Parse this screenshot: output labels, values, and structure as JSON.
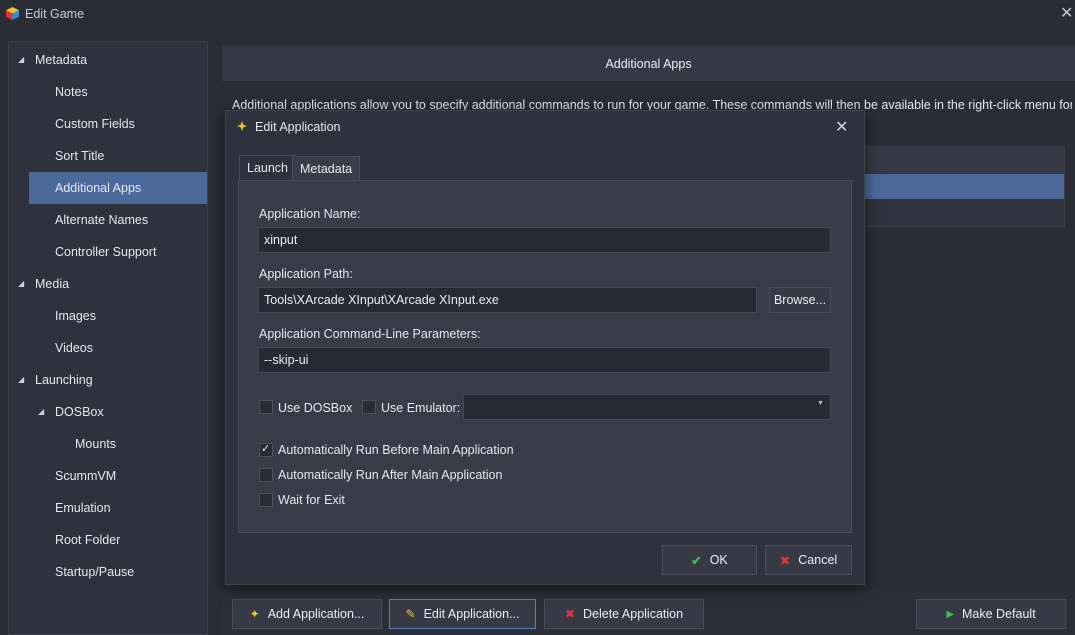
{
  "window": {
    "title": "Edit Game",
    "close_glyph": "✕"
  },
  "sidebar": {
    "items": [
      {
        "label": "Metadata",
        "expanded": true,
        "selected": false
      },
      {
        "label": "Notes",
        "selected": false
      },
      {
        "label": "Custom Fields",
        "selected": false
      },
      {
        "label": "Sort Title",
        "selected": false
      },
      {
        "label": "Additional Apps",
        "selected": true
      },
      {
        "label": "Alternate Names",
        "selected": false
      },
      {
        "label": "Controller Support",
        "selected": false
      },
      {
        "label": "Media",
        "expanded": true,
        "selected": false
      },
      {
        "label": "Images",
        "selected": false
      },
      {
        "label": "Videos",
        "selected": false
      },
      {
        "label": "Launching",
        "expanded": true,
        "selected": false
      },
      {
        "label": "DOSBox",
        "expanded": true,
        "selected": false
      },
      {
        "label": "Mounts",
        "selected": false
      },
      {
        "label": "ScummVM",
        "selected": false
      },
      {
        "label": "Emulation",
        "selected": false
      },
      {
        "label": "Root Folder",
        "selected": false
      },
      {
        "label": "Startup/Pause",
        "selected": false
      }
    ]
  },
  "main": {
    "header": "Additional Apps",
    "description": "Additional applications allow you to specify additional commands to run for your game.  These commands will then be available in the right-click menu for",
    "buttons": {
      "add": "Add Application...",
      "edit": "Edit Application...",
      "delete": "Delete Application",
      "make_default": "Make Default"
    }
  },
  "dialog": {
    "title": "Edit Application",
    "close_glyph": "✕",
    "tabs": [
      "Launch",
      "Metadata"
    ],
    "active_tab": "Launch",
    "fields": {
      "name_label": "Application Name:",
      "name_value": "xinput",
      "path_label": "Application Path:",
      "path_value": "Tools\\XArcade XInput\\XArcade XInput.exe",
      "browse_label": "Browse...",
      "params_label": "Application Command-Line Parameters:",
      "params_value": "--skip-ui"
    },
    "options": {
      "use_dosbox": {
        "label": "Use DOSBox",
        "checked": false
      },
      "use_emulator": {
        "label": "Use Emulator:",
        "checked": false
      },
      "emulator_selected": "",
      "run_before": {
        "label": "Automatically Run Before Main Application",
        "checked": true
      },
      "run_after": {
        "label": "Automatically Run After Main Application",
        "checked": false
      },
      "wait_for_exit": {
        "label": "Wait for Exit",
        "checked": false
      }
    },
    "buttons": {
      "ok": "OK",
      "cancel": "Cancel"
    }
  },
  "colors": {
    "background": "#2b2d36",
    "selection": "#4b6a9b",
    "ok_check": "#3bbf4a",
    "cancel_x": "#e0343f"
  },
  "icons": [
    "app-logo-icon",
    "collapse-arrow-icon",
    "dialog-icon",
    "close-icon",
    "add-icon",
    "pencil-icon",
    "delete-icon",
    "flag-icon",
    "checkmark-icon",
    "cancel-x-icon",
    "dropdown-arrow-icon"
  ]
}
